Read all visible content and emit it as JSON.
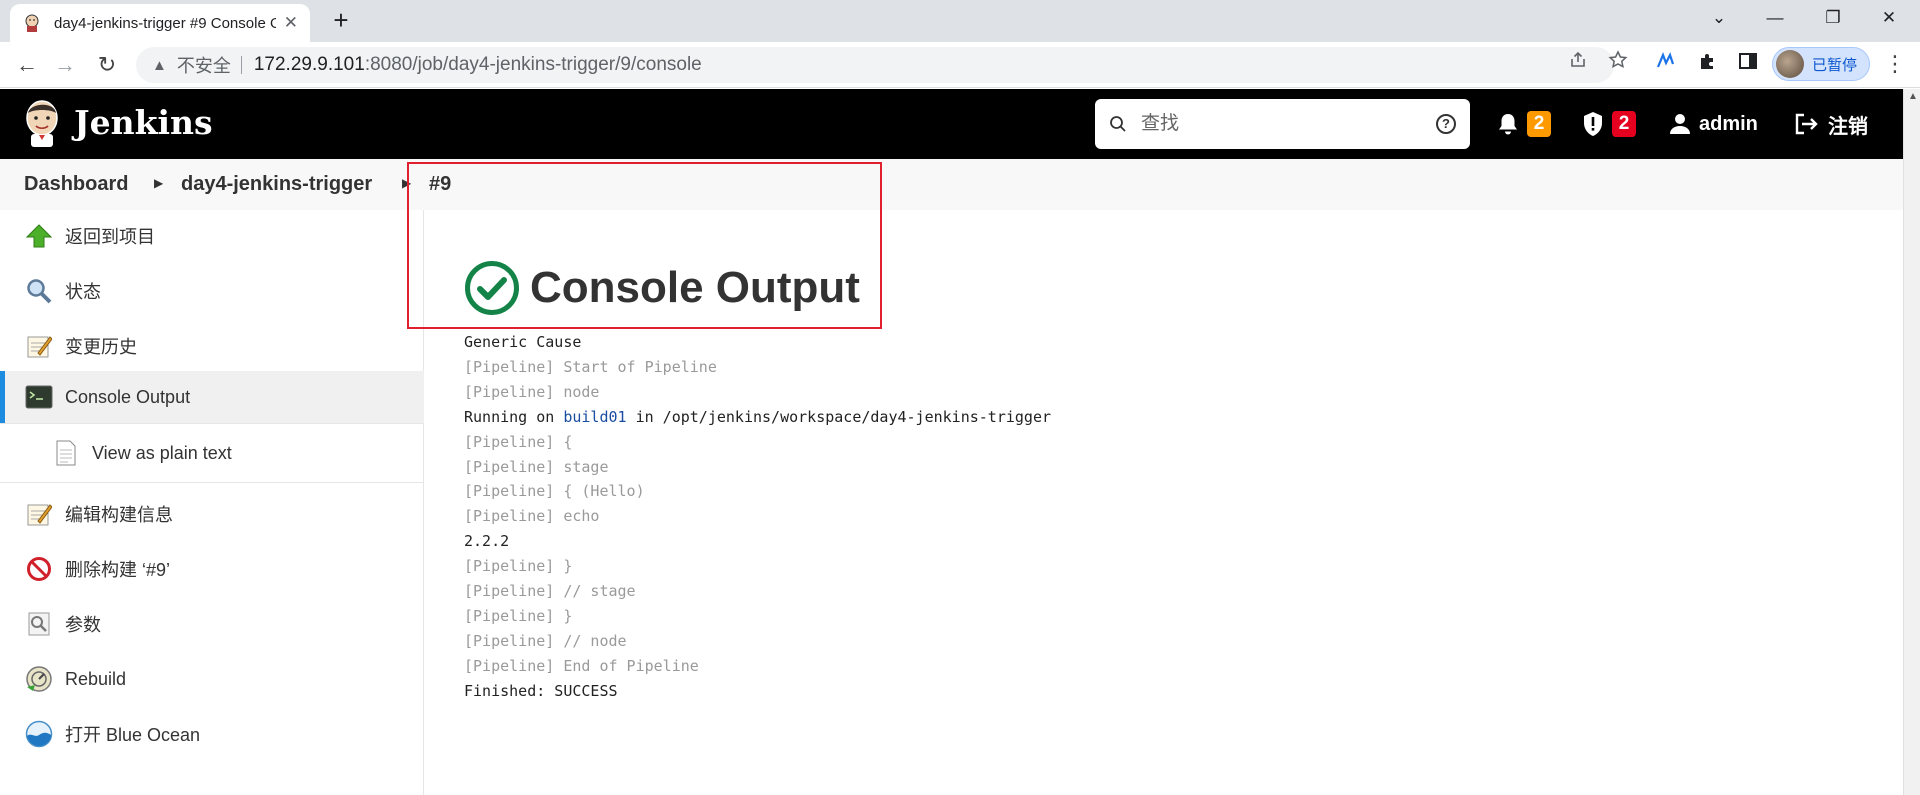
{
  "browser": {
    "tab_title": "day4-jenkins-trigger #9 Console Output [Jenkins]",
    "tab_close": "✕",
    "new_tab": "+",
    "window_controls": [
      "⌄",
      "—",
      "❐",
      "✕"
    ],
    "nav": {
      "back": "←",
      "forward": "→",
      "reload": "↻"
    },
    "address": {
      "warning_icon": "▲",
      "security_label": "不安全",
      "host": "172.29.9.101",
      "path": ":8080/job/day4-jenkins-trigger/9/console"
    },
    "profile_label": "已暂停",
    "menu": "⋮"
  },
  "header": {
    "brand": "Jenkins",
    "search_placeholder": "查找",
    "help": "?",
    "notifications_count": "2",
    "security_count": "2",
    "user": "admin",
    "logout": "注销"
  },
  "breadcrumb": {
    "items": [
      "Dashboard",
      "day4-jenkins-trigger",
      "#9"
    ]
  },
  "sidebar": {
    "items": [
      {
        "label": "返回到项目",
        "icon": "up-arrow-icon"
      },
      {
        "label": "状态",
        "icon": "magnifier-icon"
      },
      {
        "label": "变更历史",
        "icon": "notepad-icon"
      },
      {
        "label": "Console Output",
        "icon": "terminal-icon",
        "active": true
      },
      {
        "label": "View as plain text",
        "icon": "document-icon",
        "sub": true
      },
      {
        "label": "编辑构建信息",
        "icon": "notepad-icon"
      },
      {
        "label": "删除构建 ‘#9’",
        "icon": "no-entry-icon"
      },
      {
        "label": "参数",
        "icon": "settings-doc-icon"
      },
      {
        "label": "Rebuild",
        "icon": "rebuild-icon"
      },
      {
        "label": "打开 Blue Ocean",
        "icon": "blue-ocean-icon"
      }
    ]
  },
  "main": {
    "title": "Console Output",
    "status": "success",
    "console": {
      "line0": "Generic Cause",
      "line1": "[Pipeline] Start of Pipeline",
      "line2": "[Pipeline] node",
      "line3_prefix": "Running on ",
      "line3_link": "build01",
      "line3_suffix": " in /opt/jenkins/workspace/day4-jenkins-trigger",
      "line4": "[Pipeline] {",
      "line5": "[Pipeline] stage",
      "line6": "[Pipeline] { (Hello)",
      "line7": "[Pipeline] echo",
      "line8": "2.2.2",
      "line9": "[Pipeline] }",
      "line10": "[Pipeline] // stage",
      "line11": "[Pipeline] }",
      "line12": "[Pipeline] // node",
      "line13": "[Pipeline] End of Pipeline",
      "line14": "Finished: SUCCESS"
    }
  },
  "colors": {
    "jenkins_header": "#000000",
    "success_green": "#138347",
    "badge_orange": "#fe9a00",
    "badge_red": "#e6001f",
    "link_blue": "#1a4da1",
    "annotation_red": "#e0202e"
  }
}
